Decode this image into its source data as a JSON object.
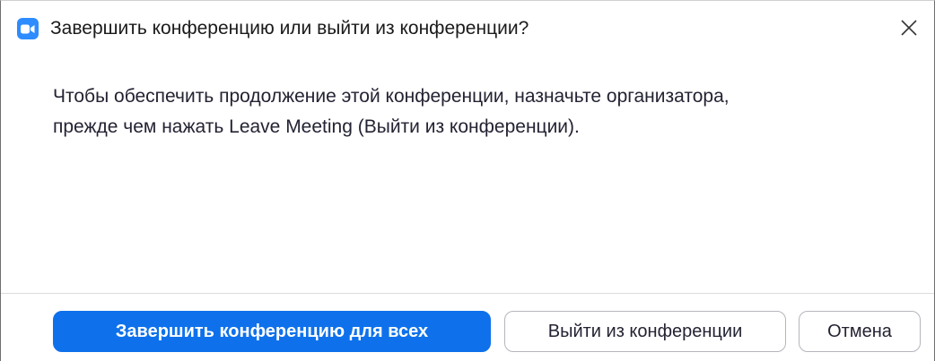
{
  "window": {
    "title": "Завершить конференцию или выйти из конференции?",
    "app_icon": "zoom-camera-icon",
    "close_icon": "close-icon"
  },
  "message": {
    "line1": "Чтобы обеспечить продолжение этой конференции, назначьте организатора,",
    "line2": "прежде чем нажать Leave Meeting (Выйти из конференции)."
  },
  "buttons": {
    "end_for_all": "Завершить конференцию для всех",
    "leave": "Выйти из конференции",
    "cancel": "Отмена"
  },
  "colors": {
    "primary": "#0e71eb",
    "app_icon": "#2d8cff"
  }
}
